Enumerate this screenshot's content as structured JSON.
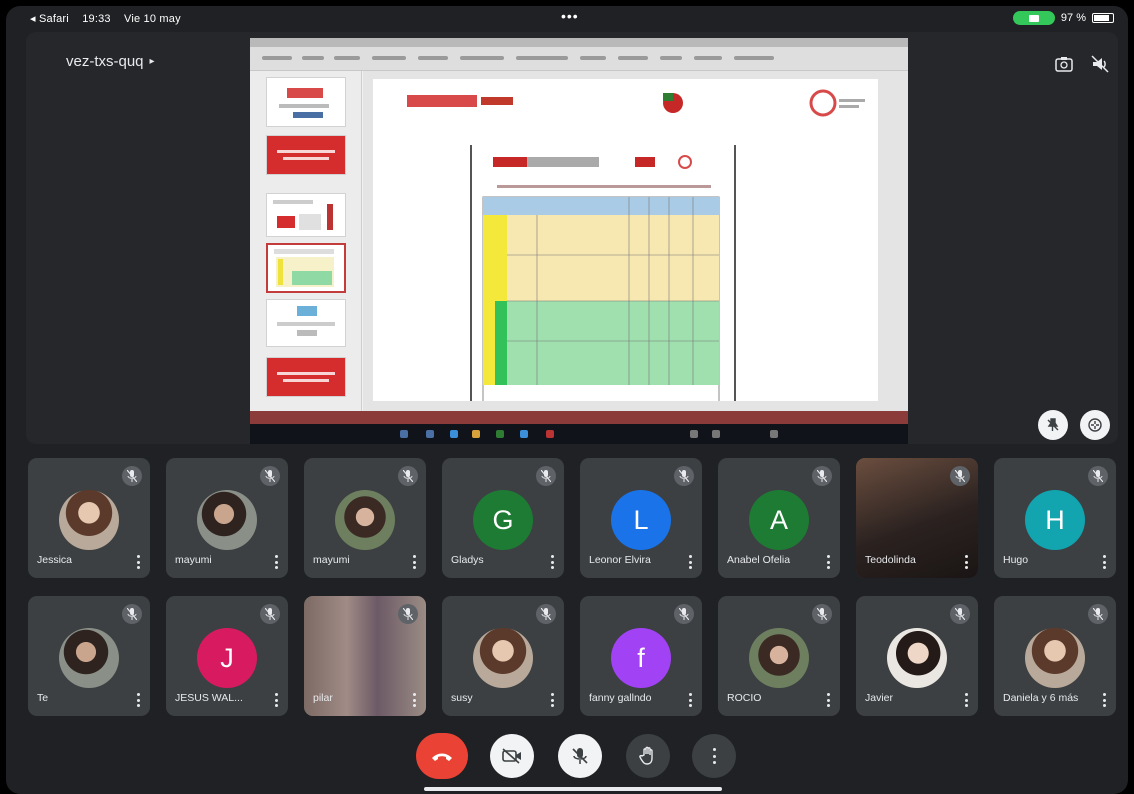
{
  "status_bar": {
    "back_app": "◂ Safari",
    "time": "19:33",
    "date": "Vie 10 may",
    "dots": "•••",
    "battery_text": "97 %"
  },
  "meeting": {
    "code": "vez-txs-quq",
    "code_chevron": "▸"
  },
  "participants_row1": [
    {
      "name": "Jessica",
      "avatar_type": "image",
      "avatar_letter": "",
      "avatar_color": ""
    },
    {
      "name": "mayumi",
      "avatar_type": "image",
      "avatar_letter": "",
      "avatar_color": ""
    },
    {
      "name": "mayumi",
      "avatar_type": "image",
      "avatar_letter": "",
      "avatar_color": ""
    },
    {
      "name": "Gladys",
      "avatar_type": "letter",
      "avatar_letter": "G",
      "avatar_color": "#1e7b34"
    },
    {
      "name": "Leonor Elvira",
      "avatar_type": "letter",
      "avatar_letter": "L",
      "avatar_color": "#1a73e8"
    },
    {
      "name": "Anabel Ofelia",
      "avatar_type": "letter",
      "avatar_letter": "A",
      "avatar_color": "#1e7b34"
    },
    {
      "name": "Teodolinda",
      "avatar_type": "video",
      "avatar_letter": "",
      "avatar_color": ""
    },
    {
      "name": "Hugo",
      "avatar_type": "letter",
      "avatar_letter": "H",
      "avatar_color": "#12a4af"
    }
  ],
  "participants_row2": [
    {
      "name": "Te",
      "avatar_type": "image",
      "avatar_letter": "",
      "avatar_color": ""
    },
    {
      "name": "JESUS WAL...",
      "avatar_type": "letter",
      "avatar_letter": "J",
      "avatar_color": "#d81b60"
    },
    {
      "name": "pilar",
      "avatar_type": "video",
      "avatar_letter": "",
      "avatar_color": ""
    },
    {
      "name": "susy",
      "avatar_type": "image",
      "avatar_letter": "",
      "avatar_color": ""
    },
    {
      "name": "fanny gallndo",
      "avatar_type": "letter",
      "avatar_letter": "f",
      "avatar_color": "#a142f4"
    },
    {
      "name": "ROCIO",
      "avatar_type": "image",
      "avatar_letter": "",
      "avatar_color": ""
    },
    {
      "name": "Javier",
      "avatar_type": "image",
      "avatar_letter": "",
      "avatar_color": ""
    },
    {
      "name": "Daniela y 6 más",
      "avatar_type": "image",
      "avatar_letter": "",
      "avatar_color": ""
    }
  ],
  "colors": {
    "background": "#202124",
    "tile": "#3c4043",
    "end_call": "#ea4335",
    "cam_indicator": "#34c759"
  },
  "icons": {
    "end_call": "phone-hangup-icon",
    "camera": "camera-off-icon",
    "mic": "mic-off-icon",
    "hand": "raise-hand-icon",
    "more": "more-vert-icon",
    "camera_switch": "camera-switch-icon",
    "speaker": "speaker-icon",
    "pin": "pin-icon",
    "fullscreen": "fullscreen-icon"
  }
}
